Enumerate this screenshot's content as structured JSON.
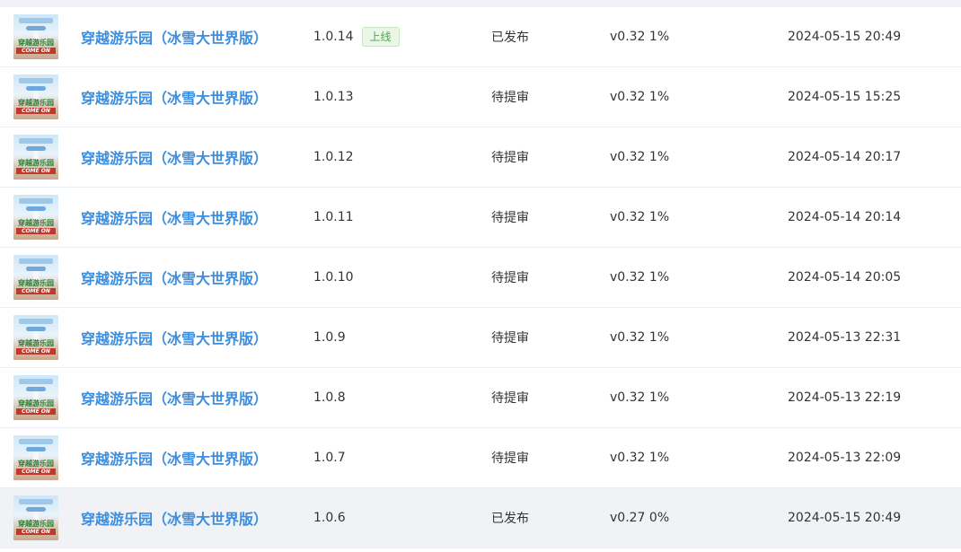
{
  "colors": {
    "link": "#3e8ede",
    "tag_text": "#4aa64a",
    "tag_bg": "#eaf7e7",
    "row_hover": "#f0f2f5",
    "divider": "#ebeef5"
  },
  "thumb": {
    "icon": "game-cover-thumbnail",
    "title_line": "穿越游乐园",
    "subtitle_line": "COME ON"
  },
  "rows": [
    {
      "name": "穿越游乐园（冰雪大世界版）",
      "version": "1.0.14",
      "tag": "上线",
      "status": "已发布",
      "sdk": "v0.32 1%",
      "time": "2024-05-15 20:49"
    },
    {
      "name": "穿越游乐园（冰雪大世界版）",
      "version": "1.0.13",
      "tag": "",
      "status": "待提审",
      "sdk": "v0.32 1%",
      "time": "2024-05-15 15:25"
    },
    {
      "name": "穿越游乐园（冰雪大世界版）",
      "version": "1.0.12",
      "tag": "",
      "status": "待提审",
      "sdk": "v0.32 1%",
      "time": "2024-05-14 20:17"
    },
    {
      "name": "穿越游乐园（冰雪大世界版）",
      "version": "1.0.11",
      "tag": "",
      "status": "待提审",
      "sdk": "v0.32 1%",
      "time": "2024-05-14 20:14"
    },
    {
      "name": "穿越游乐园（冰雪大世界版）",
      "version": "1.0.10",
      "tag": "",
      "status": "待提审",
      "sdk": "v0.32 1%",
      "time": "2024-05-14 20:05"
    },
    {
      "name": "穿越游乐园（冰雪大世界版）",
      "version": "1.0.9",
      "tag": "",
      "status": "待提审",
      "sdk": "v0.32 1%",
      "time": "2024-05-13 22:31"
    },
    {
      "name": "穿越游乐园（冰雪大世界版）",
      "version": "1.0.8",
      "tag": "",
      "status": "待提审",
      "sdk": "v0.32 1%",
      "time": "2024-05-13 22:19"
    },
    {
      "name": "穿越游乐园（冰雪大世界版）",
      "version": "1.0.7",
      "tag": "",
      "status": "待提审",
      "sdk": "v0.32 1%",
      "time": "2024-05-13 22:09"
    },
    {
      "name": "穿越游乐园（冰雪大世界版）",
      "version": "1.0.6",
      "tag": "",
      "status": "已发布",
      "sdk": "v0.27 0%",
      "time": "2024-05-15 20:49",
      "hovered": true
    }
  ]
}
